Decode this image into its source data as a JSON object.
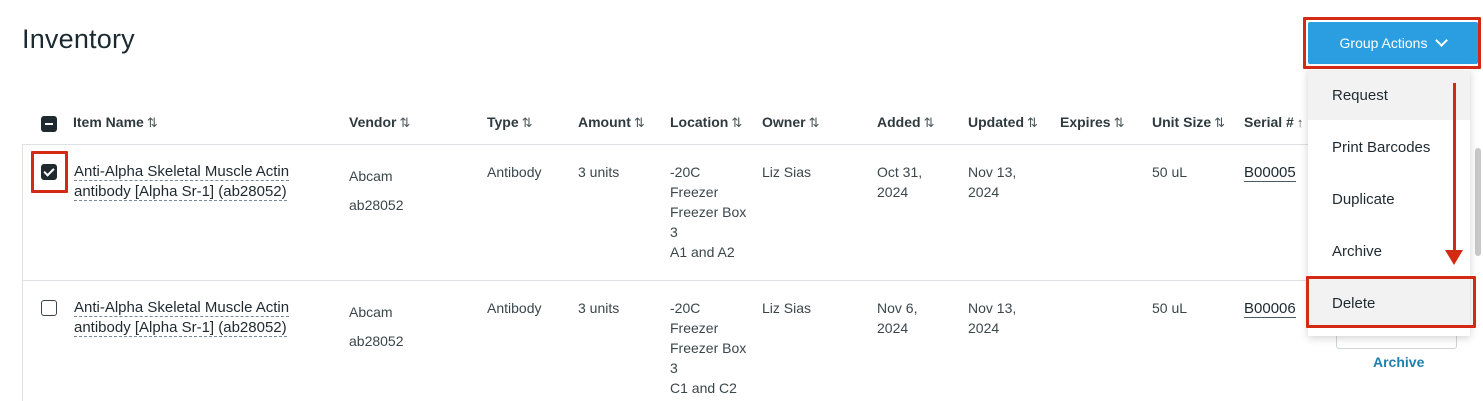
{
  "page": {
    "title": "Inventory"
  },
  "group_actions": {
    "label": "Group Actions",
    "menu": [
      "Request",
      "Print Barcodes",
      "Duplicate",
      "Archive",
      "Delete"
    ]
  },
  "table": {
    "sort_glyph": "⇅",
    "sort_glyph_up": "↑",
    "columns": [
      "Item Name",
      "Vendor",
      "Type",
      "Amount",
      "Location",
      "Owner",
      "Added",
      "Updated",
      "Expires",
      "Unit Size",
      "Serial #"
    ],
    "rows": [
      {
        "checked": true,
        "name_line1": "Anti-Alpha Skeletal Muscle Actin",
        "name_line2": "antibody [Alpha Sr-1] (ab28052)",
        "vendor_line1": "Abcam",
        "vendor_line2": "ab28052",
        "type": "Antibody",
        "amount": "3 units",
        "location": [
          "-20C",
          "Freezer",
          "Freezer Box",
          "3",
          "A1 and A2"
        ],
        "owner": "Liz Sias",
        "added_line1": "Oct 31,",
        "added_line2": "2024",
        "updated_line1": "Nov 13,",
        "updated_line2": "2024",
        "expires": "",
        "unit_size": "50 uL",
        "serial": "B00005"
      },
      {
        "checked": false,
        "name_line1": "Anti-Alpha Skeletal Muscle Actin",
        "name_line2": "antibody [Alpha Sr-1] (ab28052)",
        "vendor_line1": "Abcam",
        "vendor_line2": "ab28052",
        "type": "Antibody",
        "amount": "3 units",
        "location": [
          "-20C",
          "Freezer",
          "Freezer Box",
          "3",
          "C1 and C2"
        ],
        "owner": "Liz Sias",
        "added_line1": "Nov 6,",
        "added_line2": "2024",
        "updated_line1": "Nov 13,",
        "updated_line2": "2024",
        "expires": "",
        "unit_size": "50 uL",
        "serial": "B00006",
        "row_action": "Archive"
      }
    ]
  },
  "colors": {
    "accent": "#2a9ee0",
    "highlight": "#d42a14",
    "link": "#1e7fb0"
  }
}
